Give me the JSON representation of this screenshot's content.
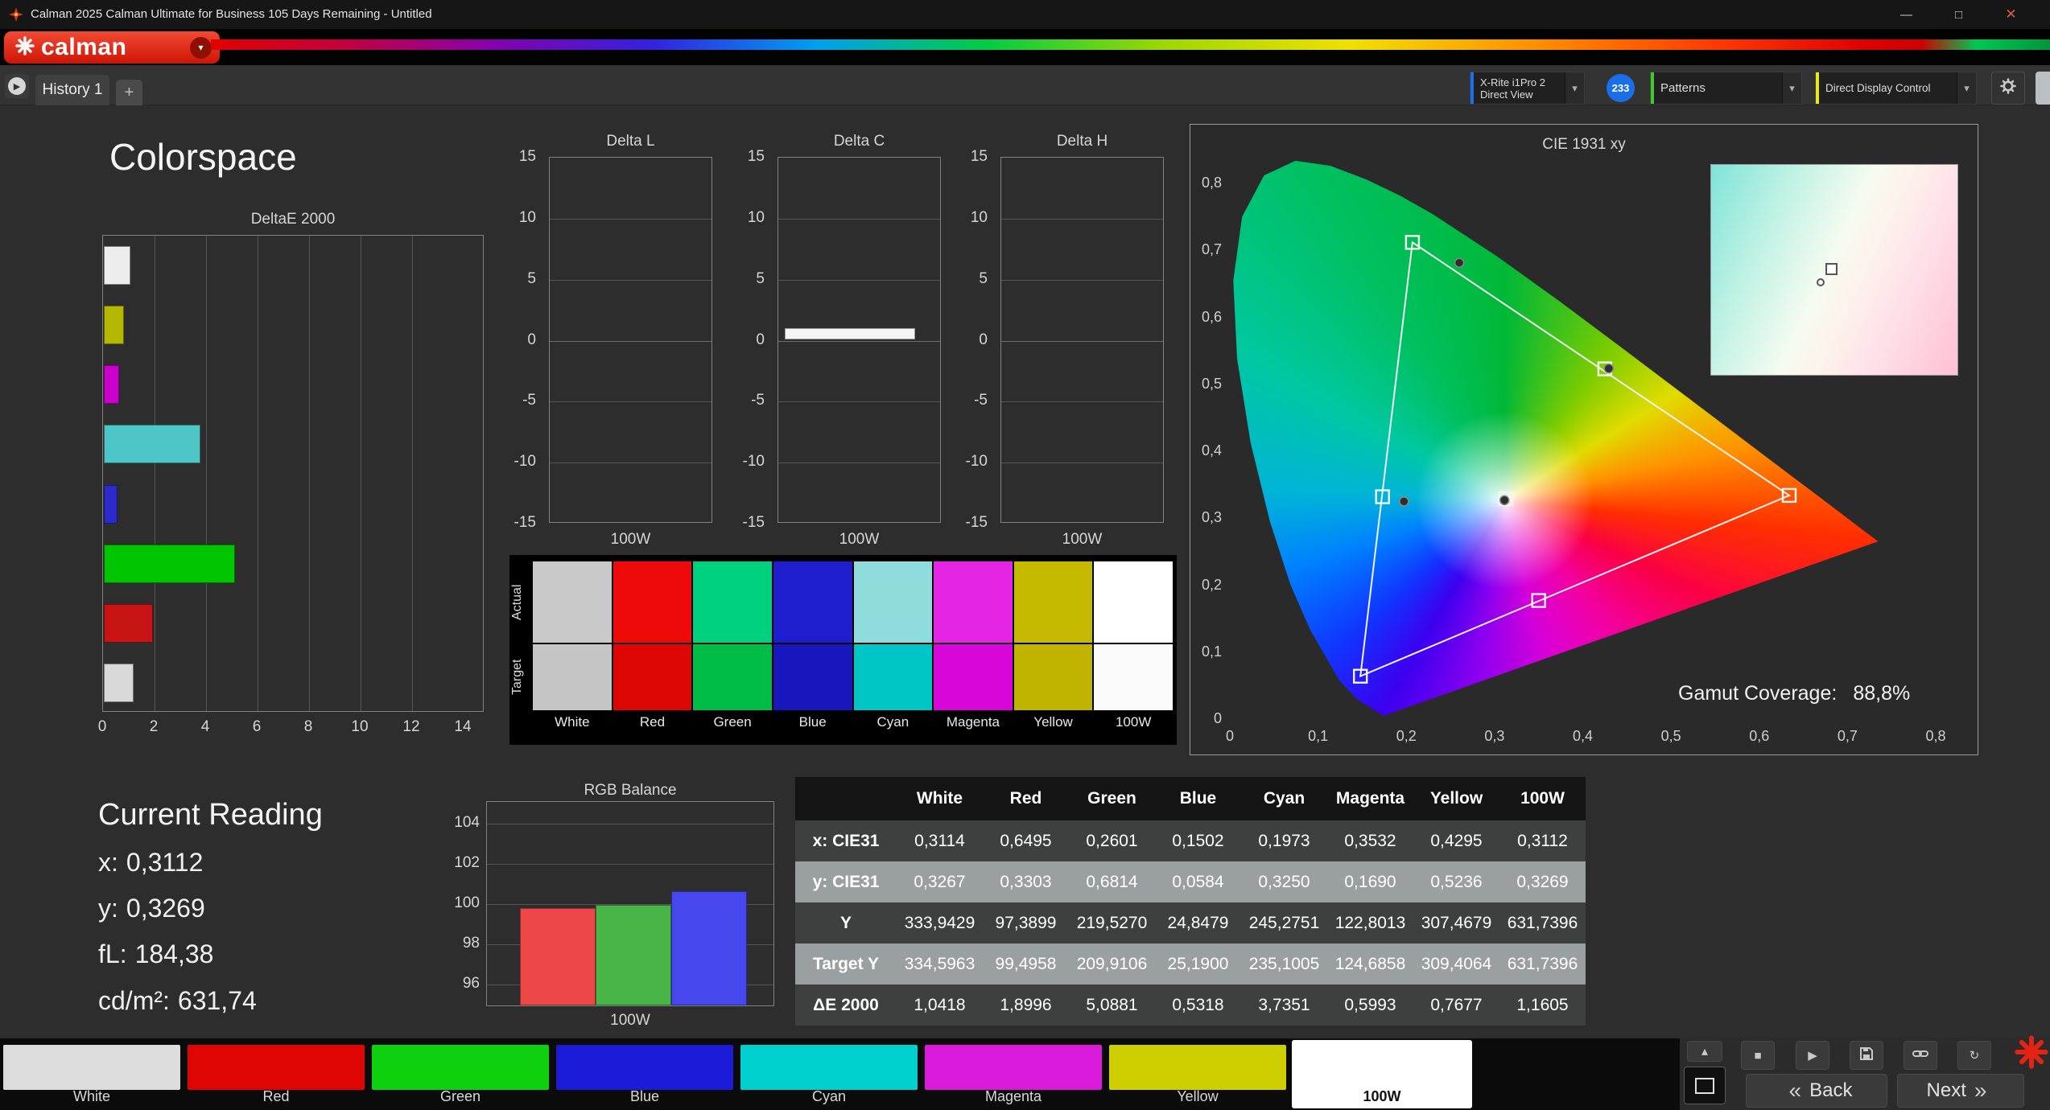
{
  "window": {
    "title": "Calman 2025 Calman Ultimate for Business 105 Days Remaining  - Untitled"
  },
  "icons": {
    "minimize": "—",
    "maximize": "□",
    "close": "✕",
    "dropdown": "▾",
    "play": "▶",
    "stop": "■",
    "refresh": "↻",
    "up": "▴",
    "back_chevron": "«",
    "next_chevron": "»",
    "plus": "+",
    "expander": "▶"
  },
  "brand": {
    "name": "calman"
  },
  "tabs": {
    "history": "History 1"
  },
  "toolbar": {
    "meter_line1": "X-Rite i1Pro 2",
    "meter_line2": "Direct View",
    "badge": "233",
    "patterns_label": "Patterns",
    "display_control_label": "Direct Display Control",
    "accent_meter": "#1c6ef2",
    "accent_patterns": "#3dcc28",
    "accent_display": "#e8e81e"
  },
  "page": {
    "heading": "Colorspace"
  },
  "deltae": {
    "title": "DeltaE 2000",
    "xtick_labels": [
      "0",
      "2",
      "4",
      "6",
      "8",
      "10",
      "12",
      "14"
    ],
    "xtick_values": [
      0,
      2,
      4,
      6,
      8,
      10,
      12,
      14
    ],
    "bars": [
      {
        "name": "White",
        "value": 1.0418,
        "color": "#ededed"
      },
      {
        "name": "Yellow",
        "value": 0.7677,
        "color": "#b5b800"
      },
      {
        "name": "Magenta",
        "value": 0.5993,
        "color": "#cc00cc"
      },
      {
        "name": "Cyan",
        "value": 3.7351,
        "color": "#4cc6c6"
      },
      {
        "name": "Blue",
        "value": 0.5318,
        "color": "#2b2bcc"
      },
      {
        "name": "Green",
        "value": 5.0881,
        "color": "#00c400"
      },
      {
        "name": "Red",
        "value": 1.8996,
        "color": "#c81414"
      },
      {
        "name": "100W",
        "value": 1.1605,
        "color": "#d9d9d9"
      }
    ]
  },
  "delta_charts": {
    "ytick_labels": [
      "15",
      "10",
      "5",
      "0",
      "-5",
      "-10",
      "-15"
    ],
    "ytick_values": [
      15,
      10,
      5,
      0,
      -5,
      -10,
      -15
    ],
    "charts": [
      {
        "title": "Delta L",
        "xlabel": "100W",
        "bar_value": null
      },
      {
        "title": "Delta C",
        "xlabel": "100W",
        "bar_value": 0.9
      },
      {
        "title": "Delta H",
        "xlabel": "100W",
        "bar_value": null
      }
    ]
  },
  "swatch_compare": {
    "row_labels": [
      "Actual",
      "Target"
    ],
    "columns": [
      {
        "name": "White",
        "actual": "#c9c9c9",
        "target": "#c5c5c5"
      },
      {
        "name": "Red",
        "actual": "#ef0a0a",
        "target": "#de0505"
      },
      {
        "name": "Green",
        "actual": "#00d17e",
        "target": "#00bd45"
      },
      {
        "name": "Blue",
        "actual": "#1e1ecf",
        "target": "#1717bd"
      },
      {
        "name": "Cyan",
        "actual": "#8fdcdc",
        "target": "#00c6c6"
      },
      {
        "name": "Magenta",
        "actual": "#e425e4",
        "target": "#d806d8"
      },
      {
        "name": "Yellow",
        "actual": "#c6ba00",
        "target": "#c0b400"
      },
      {
        "name": "100W",
        "actual": "#ffffff",
        "target": "#fbfbfb"
      }
    ]
  },
  "cie": {
    "title": "CIE 1931 xy",
    "gamut_label": "Gamut Coverage:",
    "gamut_value": "88,8%",
    "xtick_labels": [
      "0",
      "0,1",
      "0,2",
      "0,3",
      "0,4",
      "0,5",
      "0,6",
      "0,7",
      "0,8"
    ],
    "xtick_values": [
      0,
      0.1,
      0.2,
      0.3,
      0.4,
      0.5,
      0.6,
      0.7,
      0.8
    ],
    "ytick_labels": [
      "0",
      "0,1",
      "0,2",
      "0,3",
      "0,4",
      "0,5",
      "0,6",
      "0,7",
      "0,8"
    ],
    "ytick_values": [
      0,
      0.1,
      0.2,
      0.3,
      0.4,
      0.5,
      0.6,
      0.7,
      0.8
    ],
    "triangle": [
      [
        0.207,
        0.712
      ],
      [
        0.634,
        0.334
      ],
      [
        0.148,
        0.064
      ]
    ],
    "target_squares": [
      [
        0.207,
        0.712
      ],
      [
        0.425,
        0.523
      ],
      [
        0.634,
        0.334
      ],
      [
        0.35,
        0.177
      ],
      [
        0.148,
        0.064
      ],
      [
        0.173,
        0.332
      ],
      [
        0.3127,
        0.329
      ]
    ],
    "measured_dots": [
      [
        0.2601,
        0.6814
      ],
      [
        0.4295,
        0.5236
      ],
      [
        0.1973,
        0.325
      ],
      [
        0.3112,
        0.3269
      ]
    ],
    "locus": [
      [
        0.1741,
        0.005
      ],
      [
        0.144,
        0.0297
      ],
      [
        0.1241,
        0.0578
      ],
      [
        0.0913,
        0.1327
      ],
      [
        0.0687,
        0.2007
      ],
      [
        0.0454,
        0.295
      ],
      [
        0.0235,
        0.4127
      ],
      [
        0.0082,
        0.5384
      ],
      [
        0.0039,
        0.6548
      ],
      [
        0.0139,
        0.7502
      ],
      [
        0.0389,
        0.812
      ],
      [
        0.0743,
        0.8338
      ],
      [
        0.1142,
        0.8262
      ],
      [
        0.1547,
        0.8059
      ],
      [
        0.1929,
        0.7816
      ],
      [
        0.2296,
        0.7543
      ],
      [
        0.3016,
        0.6923
      ],
      [
        0.3731,
        0.6245
      ],
      [
        0.4441,
        0.5547
      ],
      [
        0.5125,
        0.4866
      ],
      [
        0.5752,
        0.4242
      ],
      [
        0.627,
        0.3725
      ],
      [
        0.6658,
        0.334
      ],
      [
        0.6915,
        0.3083
      ],
      [
        0.719,
        0.2809
      ],
      [
        0.7347,
        0.2653
      ]
    ]
  },
  "current_reading": {
    "heading": "Current Reading",
    "lines": [
      {
        "label": "x:",
        "value": "0,3112"
      },
      {
        "label": "y:",
        "value": "0,3269"
      },
      {
        "label": "fL:",
        "value": "184,38"
      },
      {
        "label": "cd/m²:",
        "value": "631,74"
      }
    ]
  },
  "rgb_balance": {
    "title": "RGB Balance",
    "xlabel": "100W",
    "ytick_labels": [
      "104",
      "102",
      "100",
      "98",
      "96"
    ],
    "ytick_values": [
      104,
      102,
      100,
      98,
      96
    ],
    "bars": [
      {
        "name": "red",
        "value": 99.8,
        "color": "#ee4747"
      },
      {
        "name": "green",
        "value": 99.95,
        "color": "#47b547"
      },
      {
        "name": "blue",
        "value": 100.65,
        "color": "#4747ee"
      }
    ]
  },
  "table": {
    "headers": [
      "",
      "White",
      "Red",
      "Green",
      "Blue",
      "Cyan",
      "Magenta",
      "Yellow",
      "100W"
    ],
    "rows": [
      {
        "label": "x: CIE31",
        "shade": "dark",
        "values": [
          "0,3114",
          "0,6495",
          "0,2601",
          "0,1502",
          "0,1973",
          "0,3532",
          "0,4295",
          "0,3112"
        ]
      },
      {
        "label": "y: CIE31",
        "shade": "light",
        "values": [
          "0,3267",
          "0,3303",
          "0,6814",
          "0,0584",
          "0,3250",
          "0,1690",
          "0,5236",
          "0,3269"
        ]
      },
      {
        "label": "Y",
        "shade": "dark",
        "values": [
          "333,9429",
          "97,3899",
          "219,5270",
          "24,8479",
          "245,2751",
          "122,8013",
          "307,4679",
          "631,7396"
        ]
      },
      {
        "label": "Target Y",
        "shade": "light",
        "values": [
          "334,5963",
          "99,4958",
          "209,9106",
          "25,1900",
          "235,1005",
          "124,6858",
          "309,4064",
          "631,7396"
        ]
      },
      {
        "label": "ΔE 2000",
        "shade": "dark",
        "values": [
          "1,0418",
          "1,8996",
          "5,0881",
          "0,5318",
          "3,7351",
          "0,5993",
          "0,7677",
          "1,1605"
        ]
      }
    ]
  },
  "pattern_bar": {
    "items": [
      {
        "label": "White",
        "color": "#dcdcdc",
        "selected": false
      },
      {
        "label": "Red",
        "color": "#e00505",
        "selected": false
      },
      {
        "label": "Green",
        "color": "#0ed00e",
        "selected": false
      },
      {
        "label": "Blue",
        "color": "#1b1bd8",
        "selected": false
      },
      {
        "label": "Cyan",
        "color": "#00cfcf",
        "selected": false
      },
      {
        "label": "Magenta",
        "color": "#da1ada",
        "selected": false
      },
      {
        "label": "Yellow",
        "color": "#cfcf00",
        "selected": false
      },
      {
        "label": "100W",
        "color": "#ffffff",
        "selected": true
      }
    ]
  },
  "nav": {
    "back": "Back",
    "next": "Next"
  }
}
